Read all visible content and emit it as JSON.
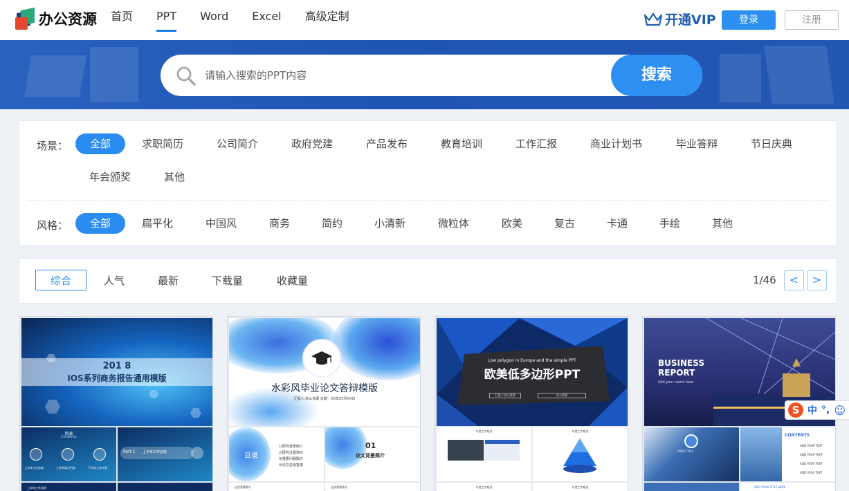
{
  "header": {
    "logo_text": "办公资源",
    "nav": [
      "首页",
      "PPT",
      "Word",
      "Excel",
      "高级定制"
    ],
    "active_nav": "PPT",
    "vip_label": "开通VIP",
    "login_label": "登录",
    "register_label": "注册"
  },
  "search": {
    "placeholder": "请输入搜索的PPT内容",
    "button_label": "搜索"
  },
  "filters": {
    "scene_label": "场景：",
    "scenes": [
      "全部",
      "求职简历",
      "公司简介",
      "政府党建",
      "产品发布",
      "教育培训",
      "工作汇报",
      "商业计划书",
      "毕业答辩",
      "节日庆典",
      "年会颁奖",
      "其他"
    ],
    "style_label": "风格：",
    "styles": [
      "全部",
      "扁平化",
      "中国风",
      "商务",
      "简约",
      "小清新",
      "微粒体",
      "欧美",
      "复古",
      "卡通",
      "手绘",
      "其他"
    ]
  },
  "sort": {
    "options": [
      "综合",
      "人气",
      "最新",
      "下载量",
      "收藏量"
    ],
    "page_indicator": "1/46",
    "prev_label": "<",
    "next_label": ">"
  },
  "cards": [
    {
      "title_line1": "201 8",
      "title_line2": "IOS系列商务报告通用模版",
      "sub1_title": "目录",
      "sub1_caption": "Contents",
      "sub1_items": [
        "上半年工作总结",
        "工作布局与目标",
        "下半年工作计划"
      ],
      "sub2_text": "Part 1",
      "sub2_caption": "上半年工作总结",
      "foot_caption": "上半年工作总结"
    },
    {
      "title": "水彩风毕业论文答辩模版",
      "subtitle": "汇报人:办公资源     日期：XX年XX月XX日",
      "toc_title": "目录",
      "toc_items": [
        "1/研究背景简介",
        "2/研究过程演示",
        "3/重要问题探讨",
        "4/论文总结答谢"
      ],
      "chapter_no": "01",
      "chapter_title": "论文背景简介",
      "foot_left": "论文背景简介",
      "foot_right": "论文背景简介"
    },
    {
      "caption_en": "Low polygon in Europe and the simple PPT",
      "title": "欧美低多边形PPT",
      "tag_left": "汇报人:办公资源",
      "tag_right": "办公资源",
      "sub1_caption": "年度工作概述",
      "sub2_caption": "年度工作概述",
      "foot_left": "年度工作概述",
      "foot_right": "年度工作概述"
    },
    {
      "title_line1": "BUSINESS",
      "title_line2": "REPORT",
      "caption": "Add your name here.",
      "sub_heading": "CONTENTS",
      "sub_items": [
        "ADD YOUR TEXT",
        "ADD YOUR TEXT",
        "ADD YOUR TEXT",
        "ADD YOUR TEXT"
      ],
      "small_caption": "YOUR TITLE",
      "foot_caption": "ADD YOUR TITLE HERE"
    }
  ],
  "ime": {
    "logo": "S",
    "label": "中",
    "symbols": "°,",
    "face_icon": "☺"
  }
}
